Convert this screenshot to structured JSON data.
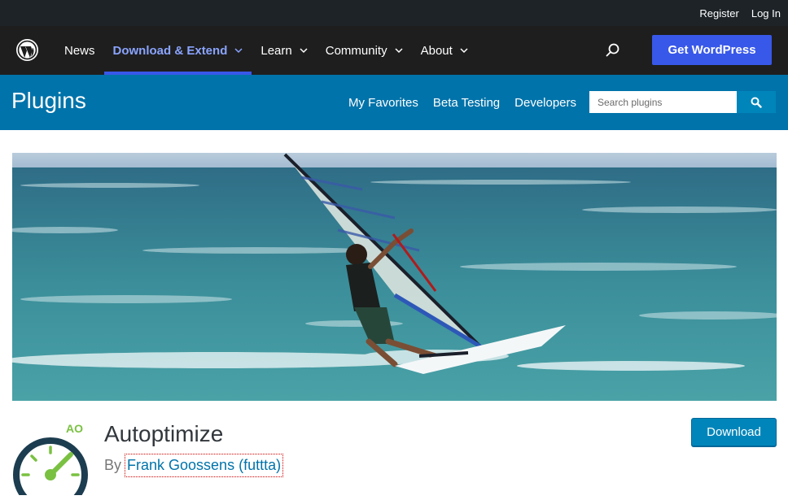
{
  "topbar": {
    "register": "Register",
    "login": "Log In"
  },
  "nav": {
    "logo_icon": "wordpress-logo-icon",
    "items": [
      {
        "label": "News",
        "dropdown": false,
        "active": false
      },
      {
        "label": "Download & Extend",
        "dropdown": true,
        "active": true
      },
      {
        "label": "Learn",
        "dropdown": true,
        "active": false
      },
      {
        "label": "Community",
        "dropdown": true,
        "active": false
      },
      {
        "label": "About",
        "dropdown": true,
        "active": false
      }
    ],
    "search_icon": "search-icon",
    "cta": "Get WordPress",
    "cta_color": "#3858e9"
  },
  "plugins_header": {
    "title": "Plugins",
    "links": [
      "My Favorites",
      "Beta Testing",
      "Developers"
    ],
    "search_placeholder": "Search plugins",
    "bar_color": "#0073aa"
  },
  "banner": {
    "image": "windsurfer-on-sea-banner"
  },
  "plugin": {
    "icon_text": "AO",
    "name": "Autoptimize",
    "by": "By",
    "author": "Frank Goossens (futtta)",
    "download_label": "Download"
  },
  "colors": {
    "nav_bg": "#1e1e1e",
    "topbar_bg": "#1d2327",
    "link": "#0073aa",
    "icon_green": "#7ac142",
    "icon_dark": "#1c3d4f"
  }
}
